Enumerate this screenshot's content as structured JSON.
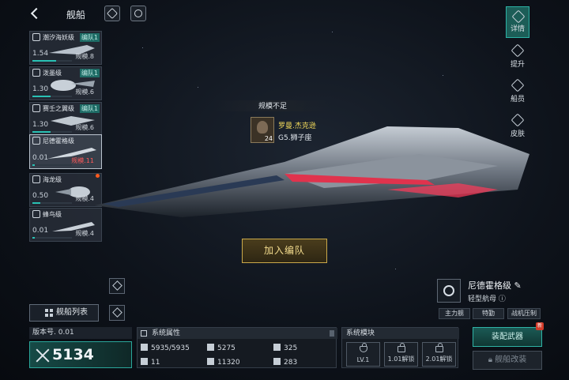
{
  "header": {
    "title": "舰船",
    "back_icon": "back-arrow-icon",
    "help_icon": "help-icon",
    "compass_icon": "compass-icon"
  },
  "ship_list": [
    {
      "name": "潮汐海妖级",
      "tag": "编队1",
      "value": "1.54",
      "scale": "规模.8",
      "progress": 0.6,
      "selected": false
    },
    {
      "name": "泼墨级",
      "tag": "编队1",
      "value": "1.30",
      "scale": "规模.6",
      "progress": 0.45,
      "selected": false
    },
    {
      "name": "赛壬之翼级",
      "tag": "编队1",
      "value": "1.30",
      "scale": "规模.6",
      "progress": 0.45,
      "selected": false
    },
    {
      "name": "尼德霍格级",
      "tag": "",
      "value": "0.01",
      "scale": "规模.11",
      "progress": 0.05,
      "selected": true,
      "scale_warn": true
    },
    {
      "name": "海龙级",
      "tag": "",
      "value": "0.50",
      "scale": "规模.4",
      "progress": 0.2,
      "selected": false,
      "new": true
    },
    {
      "name": "蜂鸟级",
      "tag": "",
      "value": "0.01",
      "scale": "规模.4",
      "progress": 0.05,
      "selected": false
    }
  ],
  "right_tabs": [
    {
      "label": "详情",
      "icon": "detail-icon",
      "active": true
    },
    {
      "label": "提升",
      "icon": "upgrade-icon",
      "active": false
    },
    {
      "label": "船员",
      "icon": "crew-icon",
      "active": false
    },
    {
      "label": "皮肤",
      "icon": "skin-icon",
      "active": false
    }
  ],
  "center": {
    "warning": "规模不足",
    "captain_name": "罗曼.杰克逊",
    "captain_sign": "G5.狮子座",
    "captain_level": "24",
    "join_button": "加入编队"
  },
  "bottom": {
    "list_button": "舰船列表",
    "version": "版本号. 0.01",
    "power": "5134",
    "attr_title": "系统属性",
    "attributes": [
      {
        "icon": "hull-icon",
        "value": "5935/5935"
      },
      {
        "icon": "armor-icon",
        "value": "5275"
      },
      {
        "icon": "shield-icon",
        "value": "325"
      },
      {
        "icon": "class-icon",
        "value": "11"
      },
      {
        "icon": "energy-icon",
        "value": "11320"
      },
      {
        "icon": "speed-icon",
        "value": "283"
      }
    ],
    "module_title": "系统模块",
    "modules": [
      {
        "label": "LV.1",
        "locked": false
      },
      {
        "label": "1.01解锁",
        "locked": true
      },
      {
        "label": "2.01解锁",
        "locked": true
      }
    ]
  },
  "ship_info": {
    "name": "尼德霍格级",
    "type": "轻型航母",
    "roles": [
      "主力舰",
      "特勤",
      "战机压制"
    ],
    "equip_button": "装配武器",
    "equip_badge": "新",
    "refit_button": "舰船改装"
  },
  "colors": {
    "accent": "#2bb2a5",
    "warning": "#ff5a5a",
    "gold": "#caa94a"
  }
}
